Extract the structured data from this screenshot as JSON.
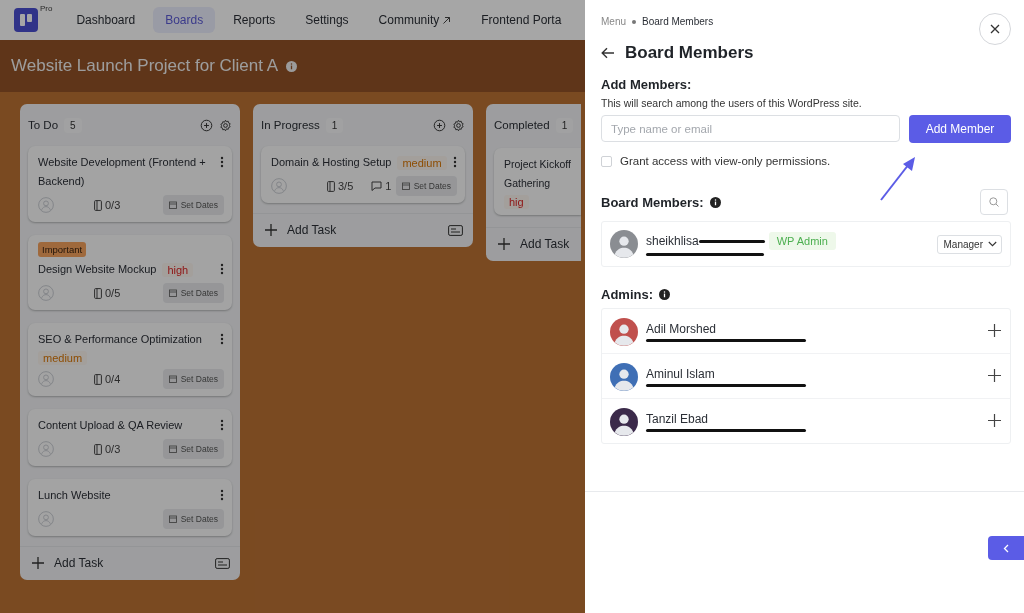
{
  "nav": {
    "badge": "Pro",
    "items": [
      {
        "label": "Dashboard",
        "selected": false,
        "external": false
      },
      {
        "label": "Boards",
        "selected": true,
        "external": false
      },
      {
        "label": "Reports",
        "selected": false,
        "external": false
      },
      {
        "label": "Settings",
        "selected": false,
        "external": false
      },
      {
        "label": "Community",
        "selected": false,
        "external": true
      },
      {
        "label": "Frontend Porta",
        "selected": false,
        "external": false
      }
    ]
  },
  "board": {
    "title": "Website Launch Project for Client A",
    "columns": [
      {
        "name": "To Do",
        "count": "5",
        "narrow": false,
        "add_task": "Add Task",
        "tasks": [
          {
            "title": "Website Development (Frontend + Backend)",
            "subtasks": "0/3",
            "date_button": "Set Dates"
          },
          {
            "tag": "Important",
            "title": "Design Website Mockup",
            "priority": {
              "label": "high",
              "kind": "high"
            },
            "subtasks": "0/5",
            "date_button": "Set Dates"
          },
          {
            "title": "SEO & Performance Optimization",
            "priority": {
              "label": "medium",
              "kind": "medium"
            },
            "subtasks": "0/4",
            "date_button": "Set Dates"
          },
          {
            "title": "Content Upload & QA Review",
            "subtasks": "0/3",
            "date_button": "Set Dates"
          },
          {
            "title": "Lunch Website",
            "date_button": "Set Dates"
          }
        ]
      },
      {
        "name": "In Progress",
        "count": "1",
        "narrow": false,
        "add_task": "Add Task",
        "tasks": [
          {
            "title": "Domain & Hosting Setup",
            "priority": {
              "label": "medium",
              "kind": "medium"
            },
            "subtasks": "3/5",
            "comments": "1",
            "date_button": "Set Dates"
          }
        ]
      },
      {
        "name": "Completed",
        "count": "1",
        "narrow": true,
        "add_task": "Add Task",
        "tasks": [
          {
            "title": "Project Kickoff Gathering",
            "priority": {
              "label": "hig",
              "kind": "high"
            }
          }
        ]
      }
    ]
  },
  "drawer": {
    "breadcrumb": [
      "Menu",
      "Board Members"
    ],
    "title": "Board Members",
    "add_members": {
      "heading": "Add Members:",
      "hint": "This will search among the users of this WordPress site.",
      "placeholder": "Type name or email",
      "button": "Add Member"
    },
    "view_only": {
      "label": "Grant access with view-only permissions.",
      "checked": false
    },
    "board_members": {
      "heading": "Board Members:",
      "members": [
        {
          "name": "sheikhlisa",
          "badge": "WP Admin",
          "role": "Manager"
        }
      ]
    },
    "admins": {
      "heading": "Admins:",
      "people": [
        {
          "name": "Adil Morshed"
        },
        {
          "name": "Aminul Islam"
        },
        {
          "name": "Tanzil Ebad"
        }
      ]
    }
  }
}
